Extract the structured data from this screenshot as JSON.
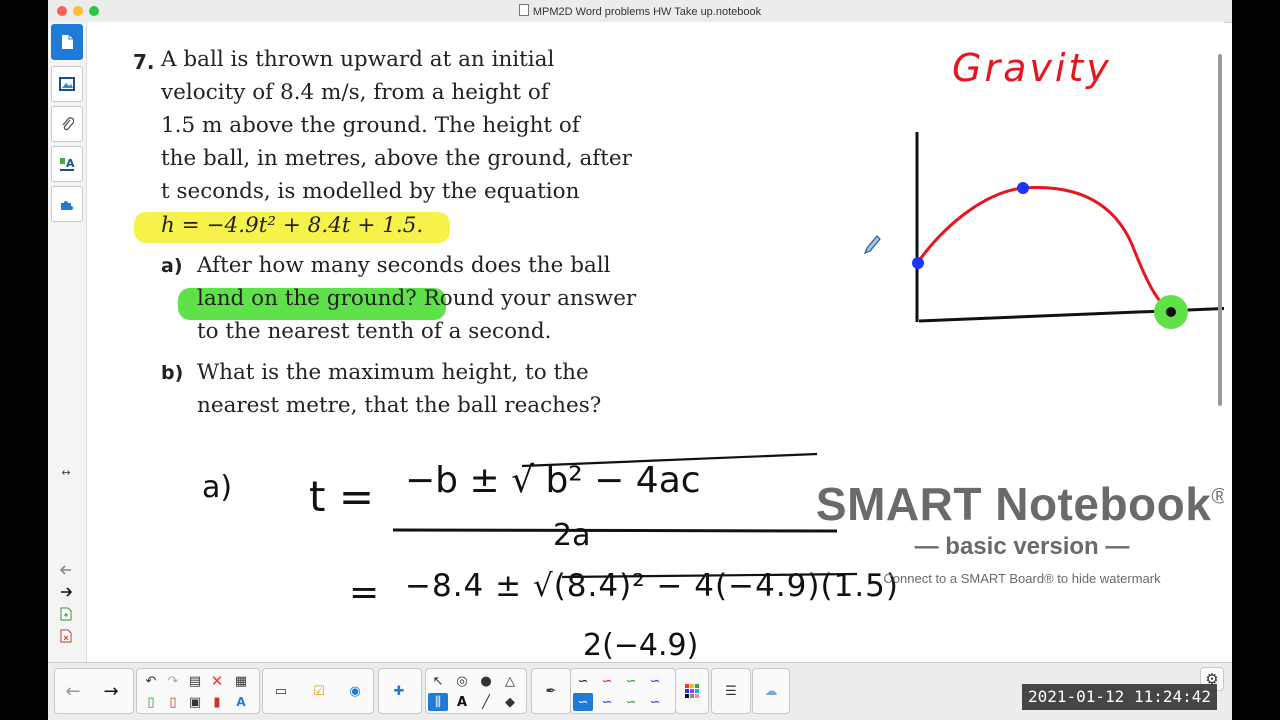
{
  "window": {
    "title": "MPM2D Word problems HW Take up.notebook",
    "traffic_colors": [
      "#fe5f57",
      "#febc2e",
      "#28c840"
    ]
  },
  "sidebar": {
    "tabs": [
      {
        "name": "page-sorter-icon",
        "active": true
      },
      {
        "name": "gallery-icon",
        "active": false
      },
      {
        "name": "attachments-icon",
        "active": false
      },
      {
        "name": "properties-icon",
        "active": false
      },
      {
        "name": "addons-icon",
        "active": false
      }
    ],
    "resize_handle": "↔"
  },
  "problem": {
    "number": "7.",
    "lines": [
      "A ball is thrown upward at an initial",
      "velocity of 8.4 m/s, from a height of",
      "1.5 m above the ground. The height of",
      "the ball, in metres, above the ground, after",
      "t seconds, is modelled by the equation"
    ],
    "equation": "h = −4.9t² + 8.4t + 1.5.",
    "part_a_label": "a)",
    "part_a_lines": [
      "After how many seconds does the ball",
      "land on the ground?",
      " Round your answer",
      "to the nearest tenth of a second."
    ],
    "part_b_label": "b)",
    "part_b_lines": [
      "What is the maximum height, to the",
      "nearest metre, that the ball reaches?"
    ]
  },
  "annotations": {
    "gravity_label": "Gravity",
    "work_label": "a)",
    "formula_lhs": "t =",
    "formula_numerator": "−b ± √ b² − 4ac",
    "formula_denominator": "2a",
    "sub_eq": "=",
    "sub_numerator": "−8.4 ± √(8.4)² − 4(−4.9)(1.5)",
    "sub_denominator": "2(−4.9)"
  },
  "watermark": {
    "title": "SMART Notebook",
    "reg": "®",
    "subtitle": "— basic version —",
    "note": "Connect to a SMART Board® to hide watermark"
  },
  "timestamp": "2021-01-12  11:24:42",
  "colors": {
    "highlight_yellow": "#f7f24a",
    "highlight_green": "#5fe14a",
    "ink_red": "#e8141e",
    "ink_blue": "#1a35ff",
    "ink_black": "#111111",
    "accent": "#1f7bd8"
  }
}
